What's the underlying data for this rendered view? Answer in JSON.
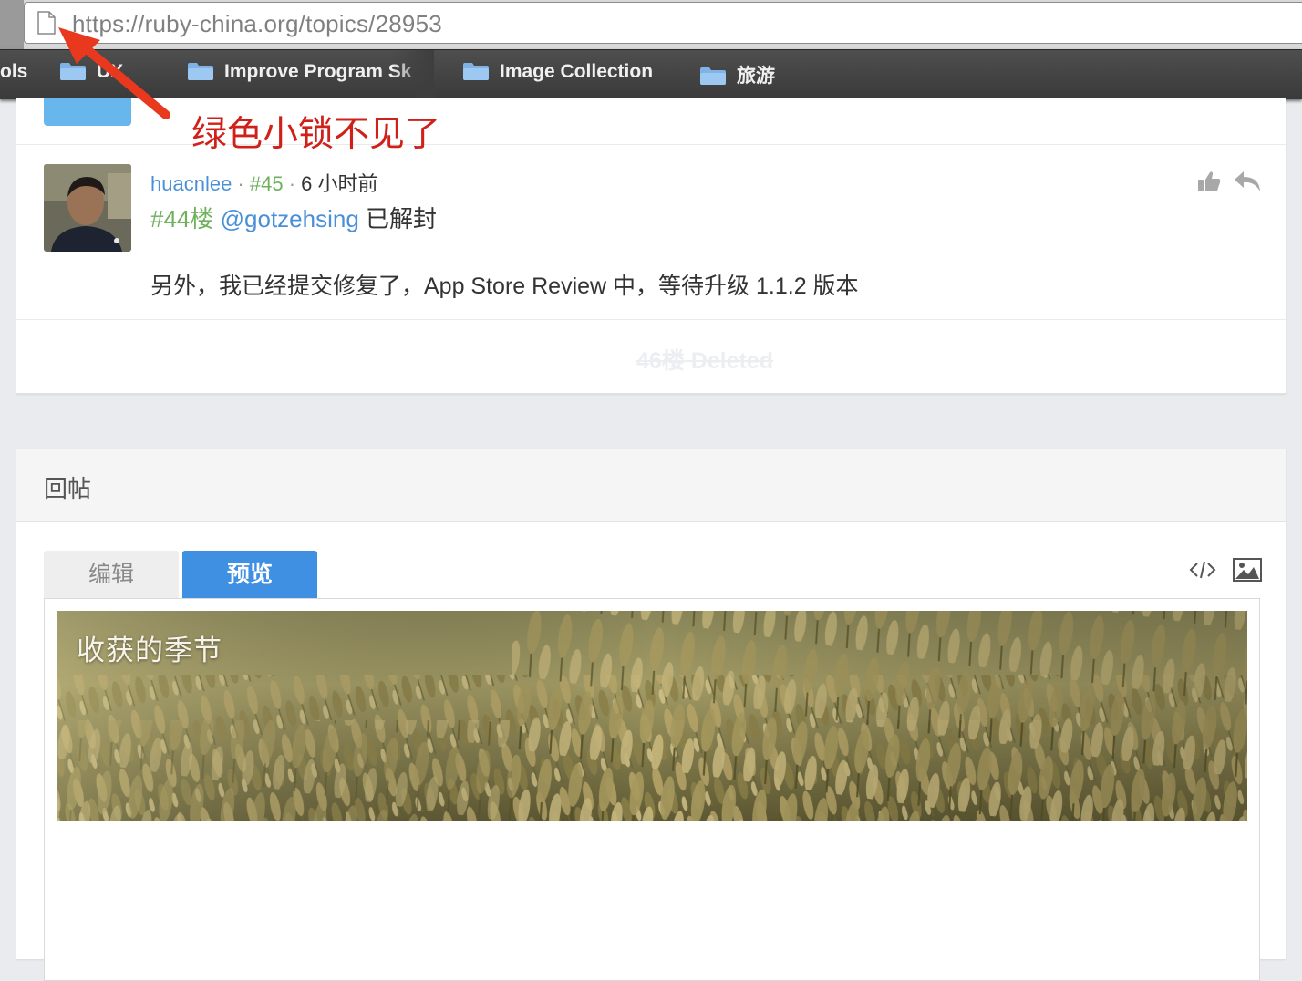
{
  "browser": {
    "url_host": "https://ruby-china.org",
    "url_path": "/topics/28953",
    "bookmarks": [
      {
        "label": "ols",
        "has_folder": false
      },
      {
        "label": "UX",
        "has_folder": true
      },
      {
        "label": "Improve Program Sk",
        "has_folder": true
      },
      {
        "label": "Image Collection",
        "has_folder": true
      },
      {
        "label": "旅游",
        "has_folder": true
      }
    ]
  },
  "annotation": {
    "text": "绿色小锁不见了",
    "color": "#d0201a"
  },
  "reply": {
    "username": "huacnlee",
    "separator": " · ",
    "floor": "#45",
    "time": "6 小时前",
    "quoted_floor": "#44楼",
    "mention": "@gotzehsing",
    "reply_text": "已解封",
    "body": "另外，我已经提交修复了，App Store Review 中，等待升级 1.1.2 版本"
  },
  "deleted_note": "46楼 Deleted",
  "reply_form": {
    "title": "回帖",
    "tabs": [
      {
        "label": "编辑",
        "active": false
      },
      {
        "label": "预览",
        "active": true
      }
    ],
    "toolbar_icons": [
      "code-icon",
      "image-icon"
    ],
    "preview_banner_title": "收获的季节"
  },
  "colors": {
    "link": "#4a90d9",
    "floor": "#6eb15c",
    "active_tab": "#3f8fe3",
    "page_bg": "#e9ebee"
  }
}
